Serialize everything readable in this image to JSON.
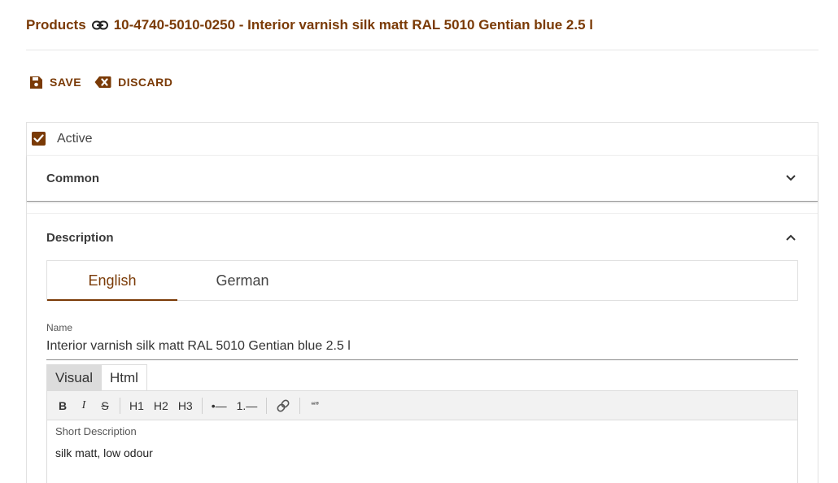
{
  "header": {
    "breadcrumb_root": "Products",
    "title": "10-4740-5010-0250 - Interior varnish silk matt RAL 5010 Gentian blue 2.5 l",
    "link_icon": "link-icon"
  },
  "toolbar": {
    "save_label": "SAVE",
    "save_icon": "floppy-disk-icon",
    "discard_label": "DISCARD",
    "discard_icon": "backspace-x-icon"
  },
  "active": {
    "label": "Active",
    "checked": true
  },
  "sections": {
    "common": {
      "title": "Common",
      "expanded": false
    },
    "description": {
      "title": "Description",
      "expanded": true
    }
  },
  "language_tabs": [
    {
      "label": "English",
      "selected": true
    },
    {
      "label": "German",
      "selected": false
    }
  ],
  "name_field": {
    "label": "Name",
    "value": "Interior varnish silk matt RAL 5010 Gentian blue 2.5 l"
  },
  "editor": {
    "modes": [
      {
        "label": "Visual",
        "selected": true
      },
      {
        "label": "Html",
        "selected": false
      }
    ],
    "format_buttons": {
      "bold": "B",
      "italic": "I",
      "strike": "S",
      "h1": "H1",
      "h2": "H2",
      "h3": "H3",
      "bullet_list": "•—",
      "ordered_list": "1.—",
      "quote": "“”"
    },
    "short_description_label": "Short Description",
    "short_description_value": "silk matt, low odour"
  },
  "colors": {
    "accent": "#7a3a06",
    "border": "#e2e2e2",
    "toolbar_bg": "#f2f2f2"
  }
}
